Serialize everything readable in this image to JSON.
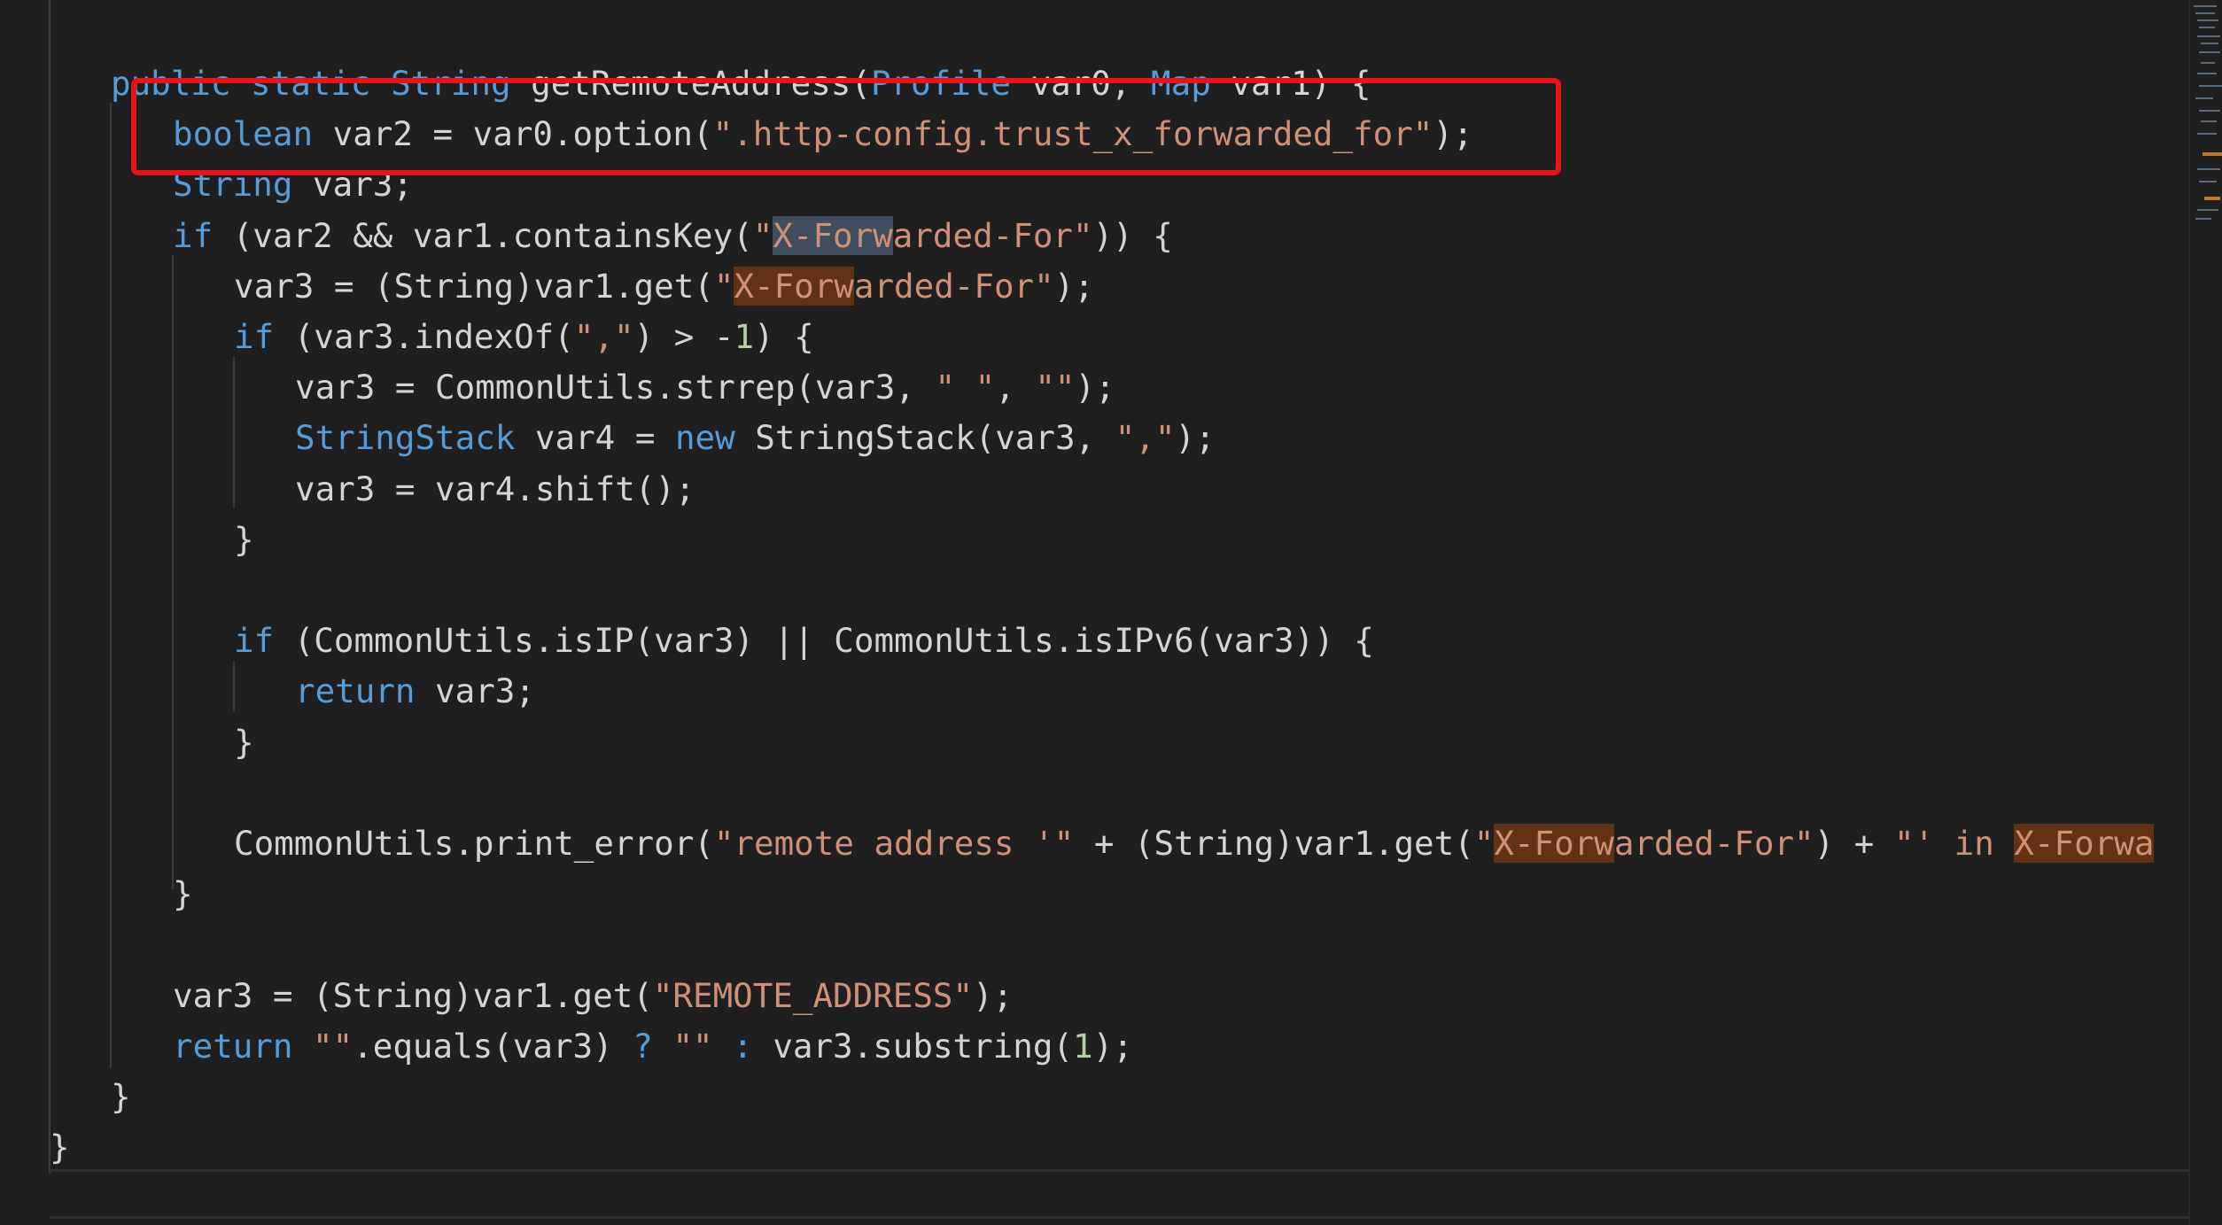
{
  "editor": {
    "lines": [
      {
        "indent": 1,
        "tokens": [
          {
            "t": "public",
            "c": "kw"
          },
          {
            "t": " ",
            "c": "pl"
          },
          {
            "t": "static",
            "c": "kw"
          },
          {
            "t": " ",
            "c": "pl"
          },
          {
            "t": "String",
            "c": "kw"
          },
          {
            "t": " getRemoteAddress(",
            "c": "pl"
          },
          {
            "t": "Profile",
            "c": "kw"
          },
          {
            "t": " var0, ",
            "c": "pl"
          },
          {
            "t": "Map",
            "c": "kw"
          },
          {
            "t": " var1) {",
            "c": "pl"
          }
        ]
      },
      {
        "indent": 2,
        "tokens": [
          {
            "t": "boolean",
            "c": "kw"
          },
          {
            "t": " var2 = var0.option(",
            "c": "pl"
          },
          {
            "t": "\".http-config.trust_x_forwarded_for\"",
            "c": "str"
          },
          {
            "t": ");",
            "c": "pl"
          }
        ]
      },
      {
        "indent": 2,
        "tokens": [
          {
            "t": "String",
            "c": "kw"
          },
          {
            "t": " var3;",
            "c": "pl"
          }
        ]
      },
      {
        "indent": 2,
        "tokens": [
          {
            "t": "if",
            "c": "kw"
          },
          {
            "t": " (var2 && var1.containsKey(",
            "c": "pl"
          },
          {
            "t": "\"",
            "c": "str"
          },
          {
            "t": "X-Forw",
            "c": "str",
            "h": "sel"
          },
          {
            "t": "arded-For\"",
            "c": "str"
          },
          {
            "t": ")) {",
            "c": "pl"
          }
        ]
      },
      {
        "indent": 3,
        "tokens": [
          {
            "t": "var3 = (String)var1.get(",
            "c": "pl"
          },
          {
            "t": "\"",
            "c": "str"
          },
          {
            "t": "X-Forw",
            "c": "str",
            "h": "match"
          },
          {
            "t": "arded-For\"",
            "c": "str"
          },
          {
            "t": ");",
            "c": "pl"
          }
        ]
      },
      {
        "indent": 3,
        "tokens": [
          {
            "t": "if",
            "c": "kw"
          },
          {
            "t": " (var3.indexOf(",
            "c": "pl"
          },
          {
            "t": "\",\"",
            "c": "str"
          },
          {
            "t": ") > -",
            "c": "pl"
          },
          {
            "t": "1",
            "c": "num"
          },
          {
            "t": ") {",
            "c": "pl"
          }
        ]
      },
      {
        "indent": 4,
        "tokens": [
          {
            "t": "var3 = CommonUtils.strrep(var3, ",
            "c": "pl"
          },
          {
            "t": "\" \"",
            "c": "str"
          },
          {
            "t": ", ",
            "c": "pl"
          },
          {
            "t": "\"\"",
            "c": "str"
          },
          {
            "t": ");",
            "c": "pl"
          }
        ]
      },
      {
        "indent": 4,
        "tokens": [
          {
            "t": "StringStack",
            "c": "kw"
          },
          {
            "t": " var4 = ",
            "c": "pl"
          },
          {
            "t": "new",
            "c": "kw"
          },
          {
            "t": " StringStack(var3, ",
            "c": "pl"
          },
          {
            "t": "\",\"",
            "c": "str"
          },
          {
            "t": ");",
            "c": "pl"
          }
        ]
      },
      {
        "indent": 4,
        "tokens": [
          {
            "t": "var3 = var4.shift();",
            "c": "pl"
          }
        ]
      },
      {
        "indent": 3,
        "tokens": [
          {
            "t": "}",
            "c": "pl"
          }
        ]
      },
      {
        "indent": 0,
        "tokens": []
      },
      {
        "indent": 3,
        "tokens": [
          {
            "t": "if",
            "c": "kw"
          },
          {
            "t": " (CommonUtils.isIP(var3) || CommonUtils.isIPv6(var3)) {",
            "c": "pl"
          }
        ]
      },
      {
        "indent": 4,
        "tokens": [
          {
            "t": "return",
            "c": "kw"
          },
          {
            "t": " var3;",
            "c": "pl"
          }
        ]
      },
      {
        "indent": 3,
        "tokens": [
          {
            "t": "}",
            "c": "pl"
          }
        ]
      },
      {
        "indent": 0,
        "tokens": []
      },
      {
        "indent": 3,
        "tokens": [
          {
            "t": "CommonUtils.print_error(",
            "c": "pl"
          },
          {
            "t": "\"remote address '\"",
            "c": "str"
          },
          {
            "t": " + (String)var1.get(",
            "c": "pl"
          },
          {
            "t": "\"",
            "c": "str"
          },
          {
            "t": "X-Forw",
            "c": "str",
            "h": "match"
          },
          {
            "t": "arded-For\"",
            "c": "str"
          },
          {
            "t": ") + ",
            "c": "pl"
          },
          {
            "t": "\"' in ",
            "c": "str"
          },
          {
            "t": "X-Forwa",
            "c": "str",
            "h": "match"
          }
        ]
      },
      {
        "indent": 2,
        "tokens": [
          {
            "t": "}",
            "c": "pl"
          }
        ]
      },
      {
        "indent": 0,
        "tokens": []
      },
      {
        "indent": 2,
        "tokens": [
          {
            "t": "var3 = (String)var1.get(",
            "c": "pl"
          },
          {
            "t": "\"REMOTE_ADDRESS\"",
            "c": "str"
          },
          {
            "t": ");",
            "c": "pl"
          }
        ]
      },
      {
        "indent": 2,
        "tokens": [
          {
            "t": "return",
            "c": "kw"
          },
          {
            "t": " ",
            "c": "pl"
          },
          {
            "t": "\"\"",
            "c": "str"
          },
          {
            "t": ".equals(var3) ",
            "c": "pl"
          },
          {
            "t": "?",
            "c": "kw"
          },
          {
            "t": " ",
            "c": "pl"
          },
          {
            "t": "\"\"",
            "c": "str"
          },
          {
            "t": " ",
            "c": "pl"
          },
          {
            "t": ":",
            "c": "kw"
          },
          {
            "t": " var3.substring(",
            "c": "pl"
          },
          {
            "t": "1",
            "c": "num"
          },
          {
            "t": ");",
            "c": "pl"
          }
        ]
      },
      {
        "indent": 1,
        "tokens": [
          {
            "t": "}",
            "c": "pl"
          }
        ]
      },
      {
        "indent": 0,
        "tokens": [
          {
            "t": "}",
            "c": "pl"
          }
        ]
      }
    ]
  },
  "colors": {
    "background": "#1f1f1f",
    "keyword": "#569cd6",
    "string": "#ce9178",
    "number": "#b5cea8",
    "plain": "#d4d4d4",
    "selection_highlight": "#3f4d5e",
    "match_highlight": "#613214",
    "annotation_box": "#e8141a"
  }
}
